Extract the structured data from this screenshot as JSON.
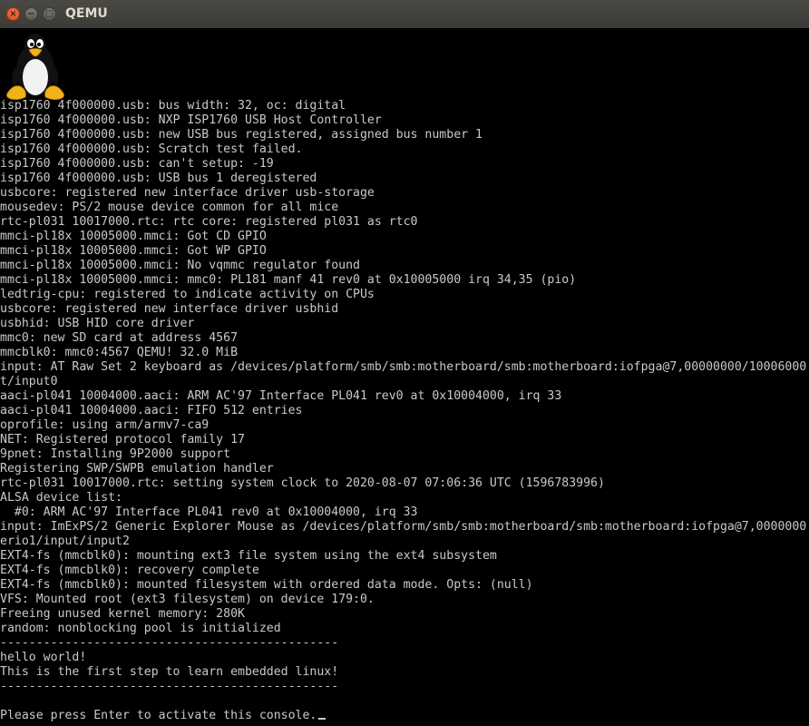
{
  "window": {
    "title": "QEMU",
    "close_glyph": "×",
    "minimize_glyph": "−",
    "maximize_glyph": "□"
  },
  "console": {
    "lines": [
      "isp1760 4f000000.usb: bus width: 32, oc: digital",
      "isp1760 4f000000.usb: NXP ISP1760 USB Host Controller",
      "isp1760 4f000000.usb: new USB bus registered, assigned bus number 1",
      "isp1760 4f000000.usb: Scratch test failed.",
      "isp1760 4f000000.usb: can't setup: -19",
      "isp1760 4f000000.usb: USB bus 1 deregistered",
      "usbcore: registered new interface driver usb-storage",
      "mousedev: PS/2 mouse device common for all mice",
      "rtc-pl031 10017000.rtc: rtc core: registered pl031 as rtc0",
      "mmci-pl18x 10005000.mmci: Got CD GPIO",
      "mmci-pl18x 10005000.mmci: Got WP GPIO",
      "mmci-pl18x 10005000.mmci: No vqmmc regulator found",
      "mmci-pl18x 10005000.mmci: mmc0: PL181 manf 41 rev0 at 0x10005000 irq 34,35 (pio)",
      "ledtrig-cpu: registered to indicate activity on CPUs",
      "usbcore: registered new interface driver usbhid",
      "usbhid: USB HID core driver",
      "mmc0: new SD card at address 4567",
      "mmcblk0: mmc0:4567 QEMU! 32.0 MiB",
      "input: AT Raw Set 2 keyboard as /devices/platform/smb/smb:motherboard/smb:motherboard:iofpga@7,00000000/10006000",
      "t/input0",
      "aaci-pl041 10004000.aaci: ARM AC'97 Interface PL041 rev0 at 0x10004000, irq 33",
      "aaci-pl041 10004000.aaci: FIFO 512 entries",
      "oprofile: using arm/armv7-ca9",
      "NET: Registered protocol family 17",
      "9pnet: Installing 9P2000 support",
      "Registering SWP/SWPB emulation handler",
      "rtc-pl031 10017000.rtc: setting system clock to 2020-08-07 07:06:36 UTC (1596783996)",
      "ALSA device list:",
      "  #0: ARM AC'97 Interface PL041 rev0 at 0x10004000, irq 33",
      "input: ImExPS/2 Generic Explorer Mouse as /devices/platform/smb/smb:motherboard/smb:motherboard:iofpga@7,0000000",
      "erio1/input/input2",
      "EXT4-fs (mmcblk0): mounting ext3 file system using the ext4 subsystem",
      "EXT4-fs (mmcblk0): recovery complete",
      "EXT4-fs (mmcblk0): mounted filesystem with ordered data mode. Opts: (null)",
      "VFS: Mounted root (ext3 filesystem) on device 179:0.",
      "Freeing unused kernel memory: 280K",
      "random: nonblocking pool is initialized",
      "-----------------------------------------------",
      "hello world!",
      "This is the first step to learn embedded linux!",
      "-----------------------------------------------",
      "",
      "Please press Enter to activate this console."
    ]
  },
  "logo": {
    "icon": "tux-penguin-icon"
  },
  "colors": {
    "titlebar": "#3c3b37",
    "title_text": "#dfdbd2",
    "close_button": "#e95420",
    "console_bg": "#000000",
    "console_text": "#c9c9c9"
  }
}
